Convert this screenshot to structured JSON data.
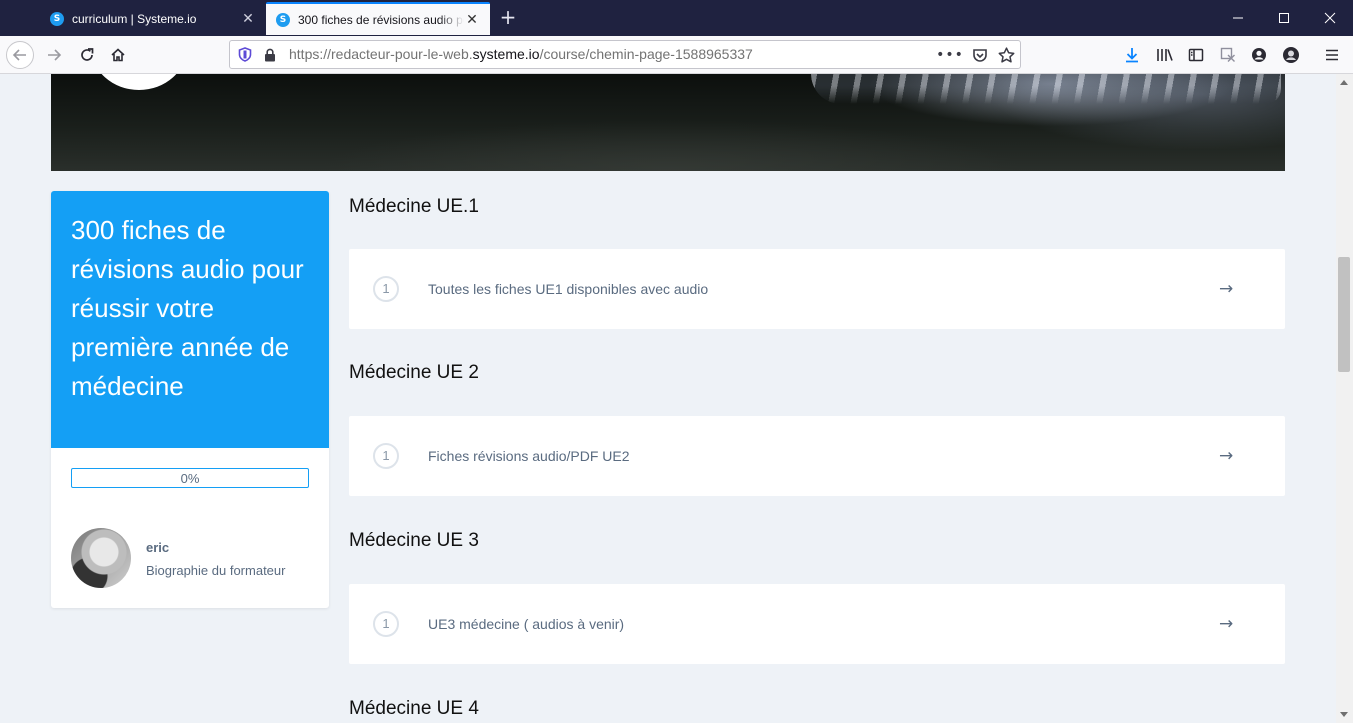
{
  "browser": {
    "tabs": [
      {
        "title": "curriculum | Systeme.io",
        "active": false
      },
      {
        "title": "300 fiches de révisions audio pour réussir votre première année de médecine",
        "active": true
      }
    ],
    "url_prefix": "https://redacteur-pour-le-web.",
    "url_domain": "systeme.io",
    "url_path": "/course/chemin-page-1588965337",
    "icons": [
      "back-icon",
      "forward-icon",
      "reload-icon",
      "home-icon",
      "shield-icon",
      "lock-icon",
      "more-icon",
      "pocket-icon",
      "star-icon",
      "download-icon",
      "library-icon",
      "sidebar-icon",
      "extension-icon",
      "account-icon",
      "profile-icon",
      "menu-icon"
    ]
  },
  "colors": {
    "accent": "#149ff5",
    "text_muted": "#5a6b80",
    "background": "#eef2f7",
    "tabbar": "#1f2240"
  },
  "sidebar": {
    "course_title": "300 fiches de révisions audio pour réussir votre première année de médecine",
    "progress": {
      "value": 0,
      "label": "0%"
    },
    "author": {
      "name": "eric",
      "bio_link": "Biographie du formateur"
    }
  },
  "modules": [
    {
      "title": "Médecine UE.1",
      "lessons": [
        {
          "number": "1",
          "title": "Toutes les fiches UE1 disponibles avec audio"
        }
      ]
    },
    {
      "title": "Médecine UE 2",
      "lessons": [
        {
          "number": "1",
          "title": "Fiches révisions audio/PDF UE2"
        }
      ]
    },
    {
      "title": "Médecine UE 3",
      "lessons": [
        {
          "number": "1",
          "title": "UE3 médecine ( audios à venir)"
        }
      ]
    },
    {
      "title": "Médecine UE 4",
      "lessons": []
    }
  ]
}
